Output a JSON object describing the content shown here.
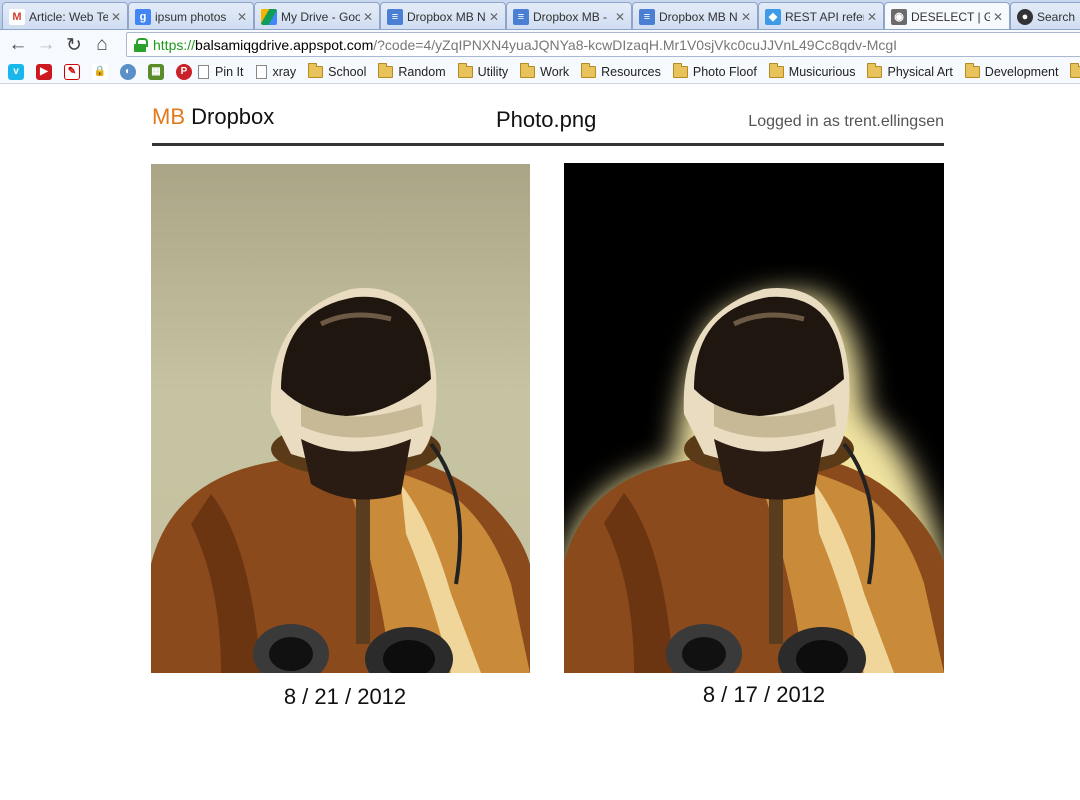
{
  "browser": {
    "tabs": [
      {
        "label": "Article: Web Te",
        "icon": "gmail-icon",
        "color": "#d23f31"
      },
      {
        "label": "ipsum photos",
        "icon": "google-icon",
        "color": "#4285f4"
      },
      {
        "label": "My Drive - Goo",
        "icon": "drive-icon",
        "color": "#f4b400"
      },
      {
        "label": "Dropbox MB N",
        "icon": "docs-icon",
        "color": "#4a7fd4"
      },
      {
        "label": "Dropbox MB -",
        "icon": "docs-icon",
        "color": "#4a7fd4"
      },
      {
        "label": "Dropbox MB N",
        "icon": "docs-icon",
        "color": "#4a7fd4"
      },
      {
        "label": "REST API refer",
        "icon": "dropbox-icon",
        "color": "#3d9ae8"
      },
      {
        "label": "DESELECT | GIM",
        "icon": "gimp-icon",
        "color": "#6b6b6b"
      },
      {
        "label": "Search",
        "icon": "github-icon",
        "color": "#333333"
      }
    ],
    "url": {
      "scheme": "https://",
      "host": "balsamiqgdrive.appspot.com",
      "path": "/?code=4/yZqIPNXN4yuaJQNYa8-kcwDIzaqH.Mr1V0sjVkc0cuJJVnL49Cc8qdv-McgI"
    },
    "bookmarks": {
      "pin_it": "Pin It",
      "xray": "xray",
      "folders": [
        "School",
        "Random",
        "Utility",
        "Work",
        "Resources",
        "Photo Floof",
        "Musicurious",
        "Physical Art",
        "Development"
      ]
    }
  },
  "app": {
    "logo_mb": "MB",
    "logo_name": "Dropbox",
    "file_title": "Photo.png",
    "logged_in": "Logged in as trent.ellingsen"
  },
  "versions": [
    {
      "date": "8 / 21 / 2012"
    },
    {
      "date": "8 / 17 / 2012"
    }
  ]
}
